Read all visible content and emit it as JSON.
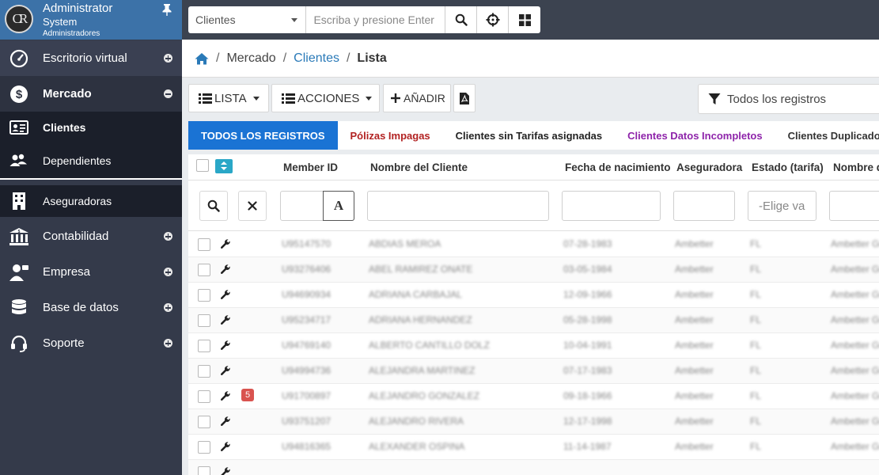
{
  "sidebar": {
    "user": {
      "logo": "CR",
      "name": "Administrator",
      "system": "System",
      "role": "Administradores"
    },
    "items": [
      {
        "label": "Escritorio virtual",
        "icon": "dashboard-icon",
        "expand": "plus"
      },
      {
        "label": "Mercado",
        "icon": "dollar-icon",
        "expand": "minus"
      },
      {
        "label": "Clientes",
        "icon": "id-card-icon"
      },
      {
        "label": "Dependientes",
        "icon": "users-icon"
      },
      {
        "label": "Aseguradoras",
        "icon": "building-icon"
      },
      {
        "label": "Contabilidad",
        "icon": "bank-icon",
        "expand": "plus"
      },
      {
        "label": "Empresa",
        "icon": "user-tie-icon",
        "expand": "plus"
      },
      {
        "label": "Base de datos",
        "icon": "database-icon",
        "expand": "plus"
      },
      {
        "label": "Soporte",
        "icon": "headset-icon",
        "expand": "plus"
      }
    ]
  },
  "topbar": {
    "search_scope": "Clientes",
    "search_placeholder": "Escriba y presione Enter"
  },
  "breadcrumb": {
    "items": [
      "Mercado",
      "Clientes",
      "Lista"
    ]
  },
  "toolbar": {
    "list_label": "LISTA",
    "actions_label": "ACCIONES",
    "add_label": "AÑADIR",
    "filter_label": "Todos los registros"
  },
  "tabs": [
    {
      "label": "TODOS LOS REGISTROS",
      "color": "#ffffff",
      "active": true
    },
    {
      "label": "Pólizas Impagas",
      "color": "#b22222"
    },
    {
      "label": "Clientes sin Tarifas asignadas",
      "color": "#222222"
    },
    {
      "label": "Clientes Datos Incompletos",
      "color": "#8e24aa"
    },
    {
      "label": "Clientes Duplicados",
      "color": "#333333"
    }
  ],
  "table": {
    "columns": [
      "Member ID",
      "Nombre del Cliente",
      "Fecha de nacimiento",
      "Aseguradora",
      "Estado (tarifa)",
      "Nombre d"
    ],
    "filters": {
      "state_placeholder": "-Elige va",
      "text_mode": "A"
    },
    "rows": [
      {
        "member_id": "U95147570",
        "name": "ABDIAS MEROA",
        "dob": "07-28-1983",
        "insurer": "Ambetter",
        "state": "FL",
        "plan": "Ambetter Gold"
      },
      {
        "member_id": "U93276406",
        "name": "ABEL RAMIREZ ONATE",
        "dob": "03-05-1984",
        "insurer": "Ambetter",
        "state": "FL",
        "plan": "Ambetter Gold"
      },
      {
        "member_id": "U94690934",
        "name": "ADRIANA CARBAJAL",
        "dob": "12-09-1966",
        "insurer": "Ambetter",
        "state": "FL",
        "plan": "Ambetter Gold"
      },
      {
        "member_id": "U95234717",
        "name": "ADRIANA HERNANDEZ",
        "dob": "05-28-1998",
        "insurer": "Ambetter",
        "state": "FL",
        "plan": "Ambetter Gold"
      },
      {
        "member_id": "U94769140",
        "name": "ALBERTO CANTILLO DOLZ",
        "dob": "10-04-1991",
        "insurer": "Ambetter",
        "state": "FL",
        "plan": "Ambetter Gold"
      },
      {
        "member_id": "U94994736",
        "name": "ALEJANDRA MARTINEZ",
        "dob": "07-17-1983",
        "insurer": "Ambetter",
        "state": "FL",
        "plan": "Ambetter Gold"
      },
      {
        "member_id": "U91700897",
        "name": "ALEJANDRO GONZALEZ",
        "dob": "09-18-1966",
        "insurer": "Ambetter",
        "state": "FL",
        "plan": "Ambetter Gold",
        "badge": "5"
      },
      {
        "member_id": "U93751207",
        "name": "ALEJANDRO RIVERA",
        "dob": "12-17-1998",
        "insurer": "Ambetter",
        "state": "FL",
        "plan": "Ambetter Gold"
      },
      {
        "member_id": "U94816365",
        "name": "ALEXANDER OSPINA",
        "dob": "11-14-1987",
        "insurer": "Ambetter",
        "state": "FL",
        "plan": "Ambetter Gold"
      }
    ]
  }
}
